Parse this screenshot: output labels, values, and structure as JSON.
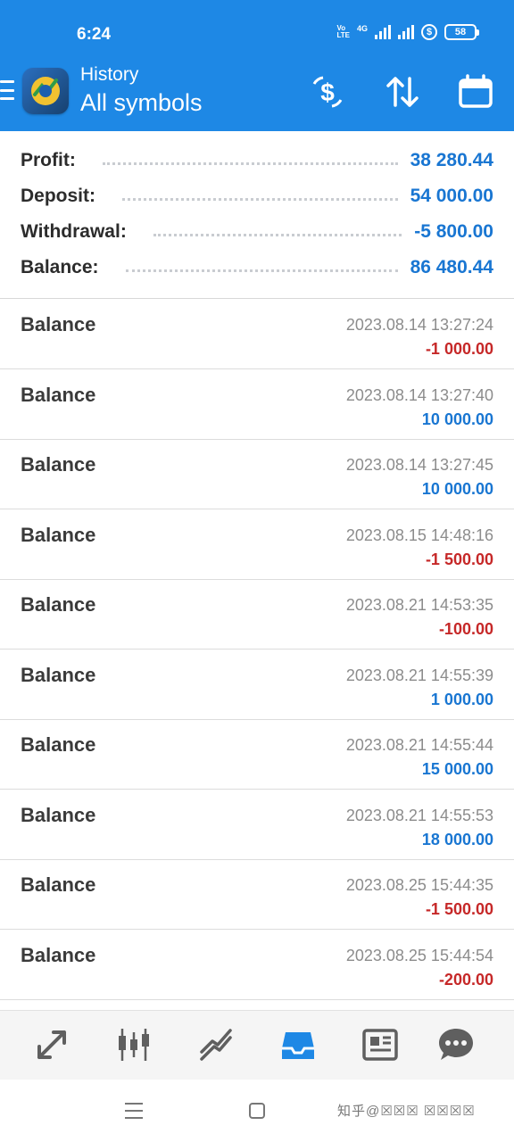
{
  "status_bar": {
    "time": "6:24",
    "network": "4G",
    "volte": "Vo LTE",
    "battery": "58"
  },
  "header": {
    "subtitle": "History",
    "title": "All symbols",
    "icons": [
      "deposit-withdraw-icon",
      "sort-icon",
      "calendar-icon"
    ],
    "color": "#1E88E5"
  },
  "summary": {
    "profit_label": "Profit:",
    "profit_value": "38 280.44",
    "deposit_label": "Deposit:",
    "deposit_value": "54 000.00",
    "withdrawal_label": "Withdrawal:",
    "withdrawal_value": "-5 800.00",
    "balance_label": "Balance:",
    "balance_value": "86 480.44"
  },
  "deals": [
    {
      "name": "Balance",
      "date": "2023.08.14 13:27:24",
      "amount": "-1 000.00",
      "negative": true
    },
    {
      "name": "Balance",
      "date": "2023.08.14 13:27:40",
      "amount": "10 000.00",
      "negative": false
    },
    {
      "name": "Balance",
      "date": "2023.08.14 13:27:45",
      "amount": "10 000.00",
      "negative": false
    },
    {
      "name": "Balance",
      "date": "2023.08.15 14:48:16",
      "amount": "-1 500.00",
      "negative": true
    },
    {
      "name": "Balance",
      "date": "2023.08.21 14:53:35",
      "amount": "-100.00",
      "negative": true
    },
    {
      "name": "Balance",
      "date": "2023.08.21 14:55:39",
      "amount": "1 000.00",
      "negative": false
    },
    {
      "name": "Balance",
      "date": "2023.08.21 14:55:44",
      "amount": "15 000.00",
      "negative": false
    },
    {
      "name": "Balance",
      "date": "2023.08.21 14:55:53",
      "amount": "18 000.00",
      "negative": false
    },
    {
      "name": "Balance",
      "date": "2023.08.25 15:44:35",
      "amount": "-1 500.00",
      "negative": true
    },
    {
      "name": "Balance",
      "date": "2023.08.25 15:44:54",
      "amount": "-200.00",
      "negative": true
    }
  ],
  "colors": {
    "positive": "#1976D2",
    "negative": "#C62828",
    "active_tab": "#1E88E5"
  },
  "tabs": [
    "quotes-icon",
    "chart-icon",
    "trade-icon",
    "history-icon",
    "news-icon",
    "messages-icon"
  ],
  "active_tab": "history-icon",
  "watermark": "知乎@☒☒☒ ☒☒☒☒"
}
